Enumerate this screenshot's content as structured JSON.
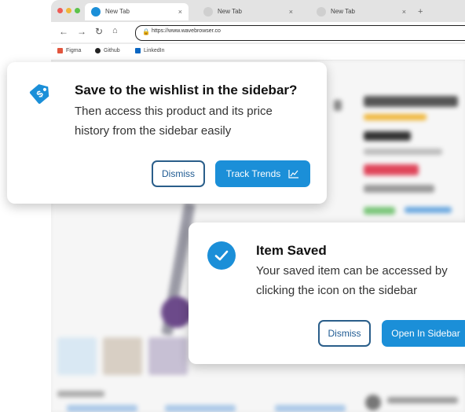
{
  "browser": {
    "tabs": [
      {
        "label": "New Tab",
        "active": true
      },
      {
        "label": "New Tab",
        "active": false
      },
      {
        "label": "New Tab",
        "active": false
      }
    ],
    "new_tab_symbol": "+",
    "tab_close_symbol": "×",
    "address": "https://www.wavebrowser.co",
    "bookmarks": [
      {
        "label": "Figma",
        "icon": "figma-icon",
        "color": "#e2553d"
      },
      {
        "label": "Github",
        "icon": "github-icon",
        "color": "#222222"
      },
      {
        "label": "LinkedIn",
        "icon": "linkedin-icon",
        "color": "#0a66c2"
      }
    ]
  },
  "wishlist_prompt": {
    "title": "Save to the wishlist in the sidebar?",
    "body_line1": "Then access this product and its price",
    "body_line2": "history from the sidebar easily",
    "dismiss_label": "Dismiss",
    "track_label": "Track Trends",
    "icon": "price-tag-icon"
  },
  "item_saved": {
    "title": "Item Saved",
    "body_line1": "Your saved item can be accessed by",
    "body_line2": "clicking the icon on the sidebar",
    "dismiss_label": "Dismiss",
    "open_label": "Open In Sidebar",
    "icon": "checkmark-icon"
  },
  "colors": {
    "accent": "#1b8fd8",
    "outline": "#2a5e8a"
  }
}
